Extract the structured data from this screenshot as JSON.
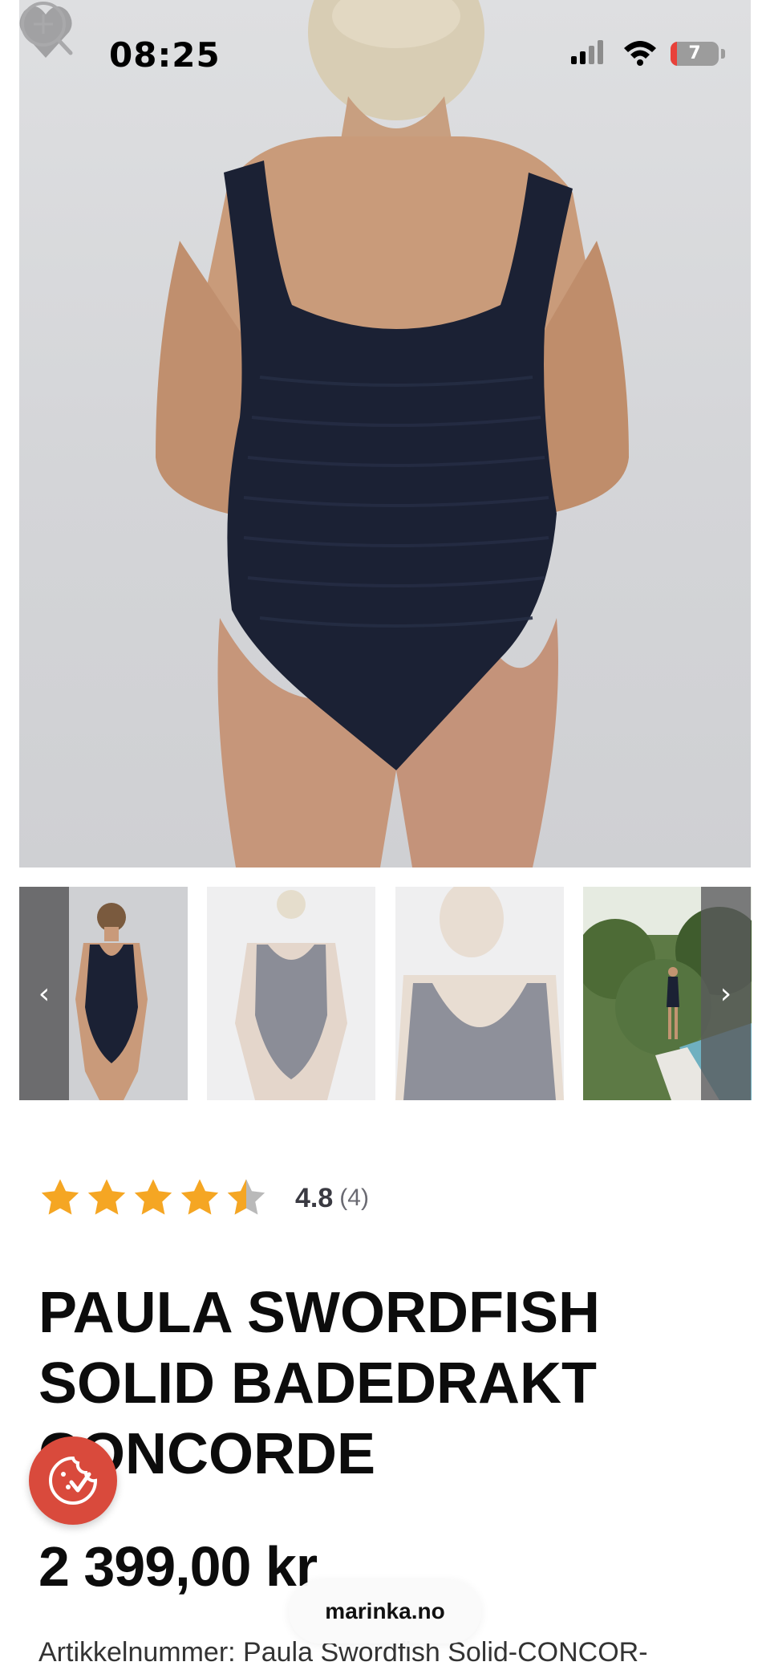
{
  "status_bar": {
    "time": "08:25",
    "battery_percent": "7",
    "battery_level": 0.07,
    "icons": [
      "signal-icon",
      "wifi-icon",
      "battery-icon"
    ]
  },
  "gallery": {
    "main_image": "swimsuit-back-view",
    "top_icons": [
      "heart-icon",
      "zoom-icon"
    ],
    "thumbnails": [
      {
        "name": "front-view"
      },
      {
        "name": "back-view"
      },
      {
        "name": "neckline-detail"
      },
      {
        "name": "outdoor-pool-view"
      }
    ],
    "prev_label": "‹",
    "next_label": "›"
  },
  "rating": {
    "stars": 4.5,
    "value": "4.8",
    "count": "(4)",
    "star_color": "#f5a623",
    "star_empty_color": "#b9b9b9"
  },
  "product": {
    "title": "PAULA SWORDFISH SOLID BADEDRAKT CONCORDE",
    "price": "2 399,00 kr",
    "sku": "Artikkelnummer: Paula Swordfish Solid-CONCOR-"
  },
  "overlays": {
    "cookie_icon": "cookie-consent-icon",
    "cookie_color": "#d94a3c",
    "domain": "marinka.no"
  }
}
